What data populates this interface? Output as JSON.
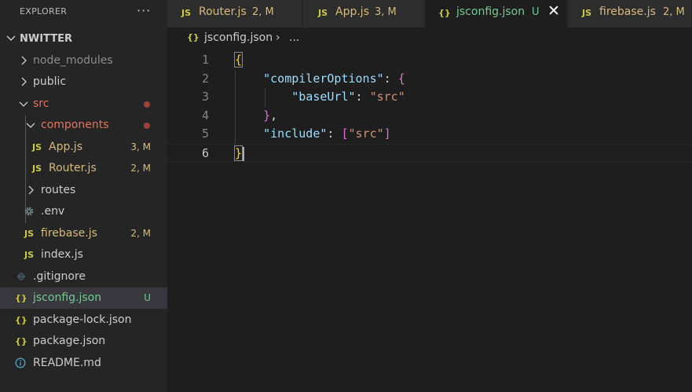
{
  "explorer": {
    "title": "EXPLORER",
    "more_label": "···",
    "project": "NWITTER",
    "items": [
      {
        "label": "node_modules",
        "type": "folder",
        "expanded": false,
        "color": "#8c8c8c",
        "status": ""
      },
      {
        "label": "public",
        "type": "folder",
        "expanded": false,
        "color": "#cccccc",
        "status": ""
      },
      {
        "label": "src",
        "type": "folder",
        "expanded": true,
        "color": "#e5735f",
        "status": "dot"
      },
      {
        "label": "components",
        "type": "folder",
        "expanded": true,
        "color": "#e5735f",
        "status": "dot"
      },
      {
        "label": "App.js",
        "type": "js",
        "icon": "JS",
        "color": "#d7ba7d",
        "status": "3, M"
      },
      {
        "label": "Router.js",
        "type": "js",
        "icon": "JS",
        "color": "#d7ba7d",
        "status": "2, M"
      },
      {
        "label": "routes",
        "type": "folder",
        "expanded": false,
        "color": "#cccccc",
        "status": ""
      },
      {
        "label": ".env",
        "type": "env",
        "icon": "gear-icon",
        "color": "#cccccc",
        "status": ""
      },
      {
        "label": "firebase.js",
        "type": "js",
        "icon": "JS",
        "color": "#d7ba7d",
        "status": "2, M"
      },
      {
        "label": "index.js",
        "type": "js",
        "icon": "JS",
        "color": "#cccccc",
        "status": ""
      },
      {
        "label": ".gitignore",
        "type": "git",
        "icon": "git-icon",
        "color": "#cccccc",
        "status": ""
      },
      {
        "label": "jsconfig.json",
        "type": "json",
        "icon": "{}",
        "color": "#73c991",
        "status": "U"
      },
      {
        "label": "package-lock.json",
        "type": "json",
        "icon": "{}",
        "color": "#cccccc",
        "status": ""
      },
      {
        "label": "package.json",
        "type": "json",
        "icon": "{}",
        "color": "#cccccc",
        "status": ""
      },
      {
        "label": "README.md",
        "type": "info",
        "icon": "info-icon",
        "color": "#cccccc",
        "status": ""
      }
    ]
  },
  "tabs": [
    {
      "icon": "JS",
      "name": "Router.js",
      "status": "2, M",
      "active": false
    },
    {
      "icon": "JS",
      "name": "App.js",
      "status": "3, M",
      "active": false
    },
    {
      "icon": "{}",
      "name": "jsconfig.json",
      "status": "U",
      "active": true,
      "close": "✕"
    },
    {
      "icon": "JS",
      "name": "firebase.js",
      "status": "2, M",
      "active": false
    }
  ],
  "breadcrumb": {
    "icon": "{}",
    "file": "jsconfig.json",
    "separator": "›",
    "more": "..."
  },
  "editor": {
    "line_numbers": [
      "1",
      "2",
      "3",
      "4",
      "5",
      "6"
    ],
    "current_line": 6,
    "code": {
      "l1_brace": "{",
      "l2_key": "\"compilerOptions\"",
      "l2_colon": ": ",
      "l2_brace": "{",
      "l3_key": "\"baseUrl\"",
      "l3_colon": ": ",
      "l3_value": "\"src\"",
      "l4_brace": "}",
      "l4_comma": ",",
      "l5_key": "\"include\"",
      "l5_colon": ": ",
      "l5_open": "[",
      "l5_value": "\"src\"",
      "l5_close": "]",
      "l6_brace": "}"
    }
  },
  "colors": {
    "modified": "#d7ba7d",
    "untracked": "#73c991",
    "error_folder": "#e5735f",
    "js_icon": "#cbcb41",
    "json_icon": "#cbcb41"
  }
}
